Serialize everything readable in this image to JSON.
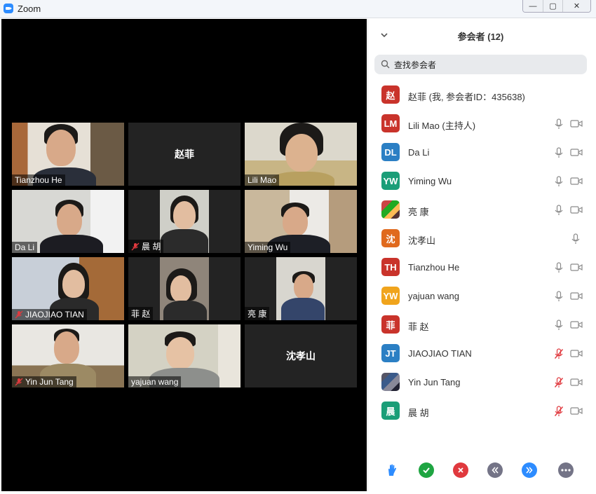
{
  "window": {
    "title": "Zoom",
    "minimize": "—",
    "maximize": "▢",
    "close": "✕"
  },
  "tiles": [
    {
      "name": "Tianzhou He",
      "kind": "video"
    },
    {
      "name": "赵菲",
      "kind": "placeholder"
    },
    {
      "name": "Lili Mao",
      "kind": "video"
    },
    {
      "name": "Da Li",
      "kind": "video"
    },
    {
      "name": "晨 胡",
      "kind": "video",
      "muted": true
    },
    {
      "name": "Yiming Wu",
      "kind": "video",
      "active": true
    },
    {
      "name": "JIAOJIAO TIAN",
      "kind": "video",
      "muted": true
    },
    {
      "name": "菲 赵",
      "kind": "video"
    },
    {
      "name": "亮 康",
      "kind": "video"
    },
    {
      "name": "Yin Jun Tang",
      "kind": "video",
      "muted": true
    },
    {
      "name": "yajuan wang",
      "kind": "video"
    },
    {
      "name": "沈孝山",
      "kind": "placeholder"
    }
  ],
  "panel": {
    "title": "参会者 (12)",
    "search_placeholder": "查找参会者",
    "participants": [
      {
        "initials": "赵",
        "name": "赵菲 (我, 参会者ID：435638)",
        "color": "#c9332b",
        "mic": "none",
        "cam": false
      },
      {
        "initials": "LM",
        "name": "Lili Mao (主持人)",
        "color": "#c9332b",
        "mic": "on",
        "cam": true
      },
      {
        "initials": "DL",
        "name": "Da Li",
        "color": "#2b7fc4",
        "mic": "on",
        "cam": true
      },
      {
        "initials": "YW",
        "name": "Yiming Wu",
        "color": "#1a9e78",
        "mic": "on",
        "cam": true
      },
      {
        "initials": "",
        "name": "亮 康",
        "color": "photo",
        "mic": "on",
        "cam": true
      },
      {
        "initials": "沈",
        "name": "沈孝山",
        "color": "#e06a1e",
        "mic": "on",
        "cam": false
      },
      {
        "initials": "TH",
        "name": "Tianzhou He",
        "color": "#c9332b",
        "mic": "on",
        "cam": true
      },
      {
        "initials": "YW",
        "name": "yajuan wang",
        "color": "#f0a41c",
        "mic": "on",
        "cam": true
      },
      {
        "initials": "菲",
        "name": "菲 赵",
        "color": "#c9332b",
        "mic": "on",
        "cam": true
      },
      {
        "initials": "JT",
        "name": "JIAOJIAO TIAN",
        "color": "#2b7fc4",
        "mic": "muted",
        "cam": true
      },
      {
        "initials": "",
        "name": "Yin Jun Tang",
        "color": "photo2",
        "mic": "muted",
        "cam": true
      },
      {
        "initials": "晨",
        "name": "晨 胡",
        "color": "#1a9e78",
        "mic": "muted",
        "cam": true
      }
    ]
  },
  "footer": {
    "icons": [
      "raise-hand-icon",
      "yes-icon",
      "no-icon",
      "slower-icon",
      "faster-icon",
      "more-icon"
    ],
    "colors": {
      "hand": "#2d8cff",
      "yes": "#1fa542",
      "no": "#e0393e",
      "slower": "#747487",
      "faster": "#2d8cff",
      "more": "#747487"
    }
  }
}
